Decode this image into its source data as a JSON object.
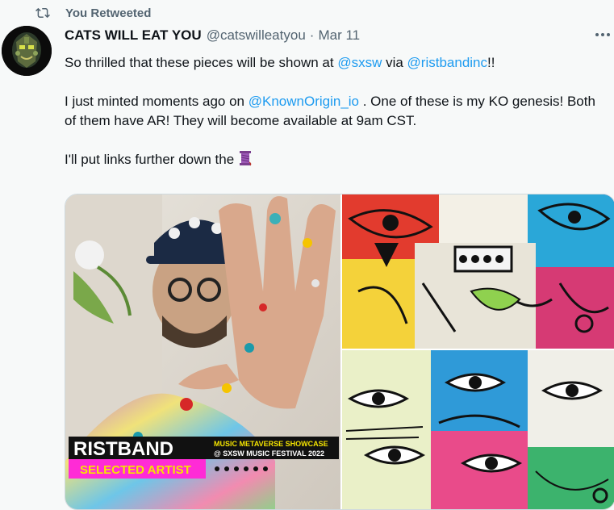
{
  "retweet": {
    "label": "You Retweeted",
    "icon": "retweet-icon"
  },
  "tweet": {
    "author_name": "CATS WILL EAT YOU",
    "handle": "@catswilleatyou",
    "separator": "·",
    "date": "Mar 11",
    "p1": {
      "before": "So thrilled that these pieces will be shown at ",
      "mention1": "@sxsw",
      "middle": " via ",
      "mention2": "@ristbandinc",
      "after": "!!"
    },
    "p2": {
      "before": "I just minted moments ago on ",
      "mention": "@KnownOrigin_io",
      "after": " . One of these is my KO genesis! Both of them have AR! They will become available at 9am CST."
    },
    "p3": {
      "text": "I'll put links further down the",
      "emoji": "thread-icon"
    }
  },
  "badge": {
    "brand": "RISTBAND",
    "line1": "MUSIC METAVERSE SHOWCASE",
    "line2": "@ SXSW MUSIC FESTIVAL 2022",
    "selected": "SELECTED ARTIST"
  },
  "colors": {
    "link": "#1d9bf0",
    "muted": "#536471",
    "text": "#0f1419",
    "bg": "#f7f9f9",
    "badge_pink": "#ff2bd6"
  }
}
